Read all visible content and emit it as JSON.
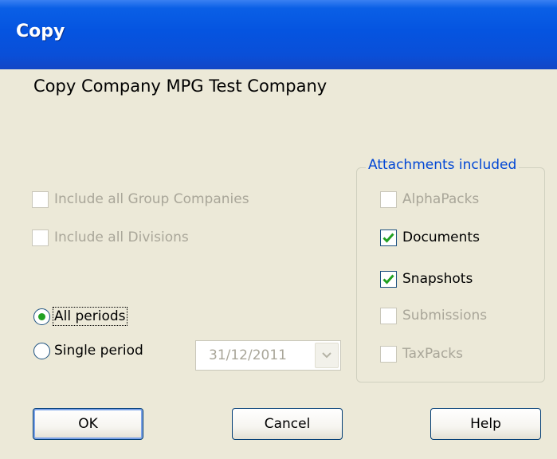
{
  "window": {
    "title": "Copy"
  },
  "heading": "Copy Company MPG Test Company",
  "options": {
    "group_companies": {
      "label": "Include all Group Companies",
      "checked": false,
      "enabled": false
    },
    "divisions": {
      "label": "Include all Divisions",
      "checked": false,
      "enabled": false
    }
  },
  "periods": {
    "all": {
      "label": "All periods",
      "selected": true
    },
    "single": {
      "label": "Single period",
      "selected": false
    },
    "date_value": "31/12/2011"
  },
  "attachments": {
    "title": "Attachments included",
    "items": [
      {
        "label": "AlphaPacks",
        "checked": false,
        "enabled": false
      },
      {
        "label": "Documents",
        "checked": true,
        "enabled": true
      },
      {
        "label": "Snapshots",
        "checked": true,
        "enabled": true
      },
      {
        "label": "Submissions",
        "checked": false,
        "enabled": false
      },
      {
        "label": "TaxPacks",
        "checked": false,
        "enabled": false
      }
    ]
  },
  "buttons": {
    "ok": "OK",
    "cancel": "Cancel",
    "help": "Help"
  },
  "colors": {
    "titlebar": "#0554e0",
    "group_title": "#0046d5",
    "check": "#21a121",
    "disabled_text": "#a9a699"
  }
}
